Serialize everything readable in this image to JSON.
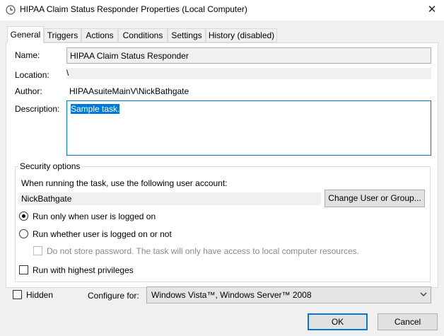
{
  "window": {
    "title": "HIPAA Claim Status Responder Properties (Local Computer)",
    "close_glyph": "✕"
  },
  "tabs": [
    {
      "label": "General",
      "active": true
    },
    {
      "label": "Triggers"
    },
    {
      "label": "Actions"
    },
    {
      "label": "Conditions"
    },
    {
      "label": "Settings"
    },
    {
      "label": "History (disabled)"
    }
  ],
  "general": {
    "name_label": "Name:",
    "name_value": "HIPAA Claim Status Responder",
    "location_label": "Location:",
    "location_value": "\\",
    "author_label": "Author:",
    "author_value": "HIPAAsuiteMainV\\NickBathgate",
    "description_label": "Description:",
    "description_value": "Sample task."
  },
  "security": {
    "group_title": "Security options",
    "account_prompt": "When running the task, use the following user account:",
    "user_account": "NickBathgate",
    "change_button": "Change User or Group...",
    "radio_logged_on": "Run only when user is logged on",
    "radio_whether": "Run whether user is logged on or not",
    "no_store_password": "Do not store password.  The task will only have access to local computer resources.",
    "highest_privileges": "Run with highest privileges"
  },
  "footer": {
    "hidden_label": "Hidden",
    "configure_label": "Configure for:",
    "configure_value": "Windows Vista™, Windows Server™ 2008",
    "ok_button": "OK",
    "cancel_button": "Cancel"
  },
  "icons": {
    "title_icon": "clock-icon",
    "dropdown": "chevron-down-icon"
  },
  "colors": {
    "accent": "#0078d7"
  }
}
